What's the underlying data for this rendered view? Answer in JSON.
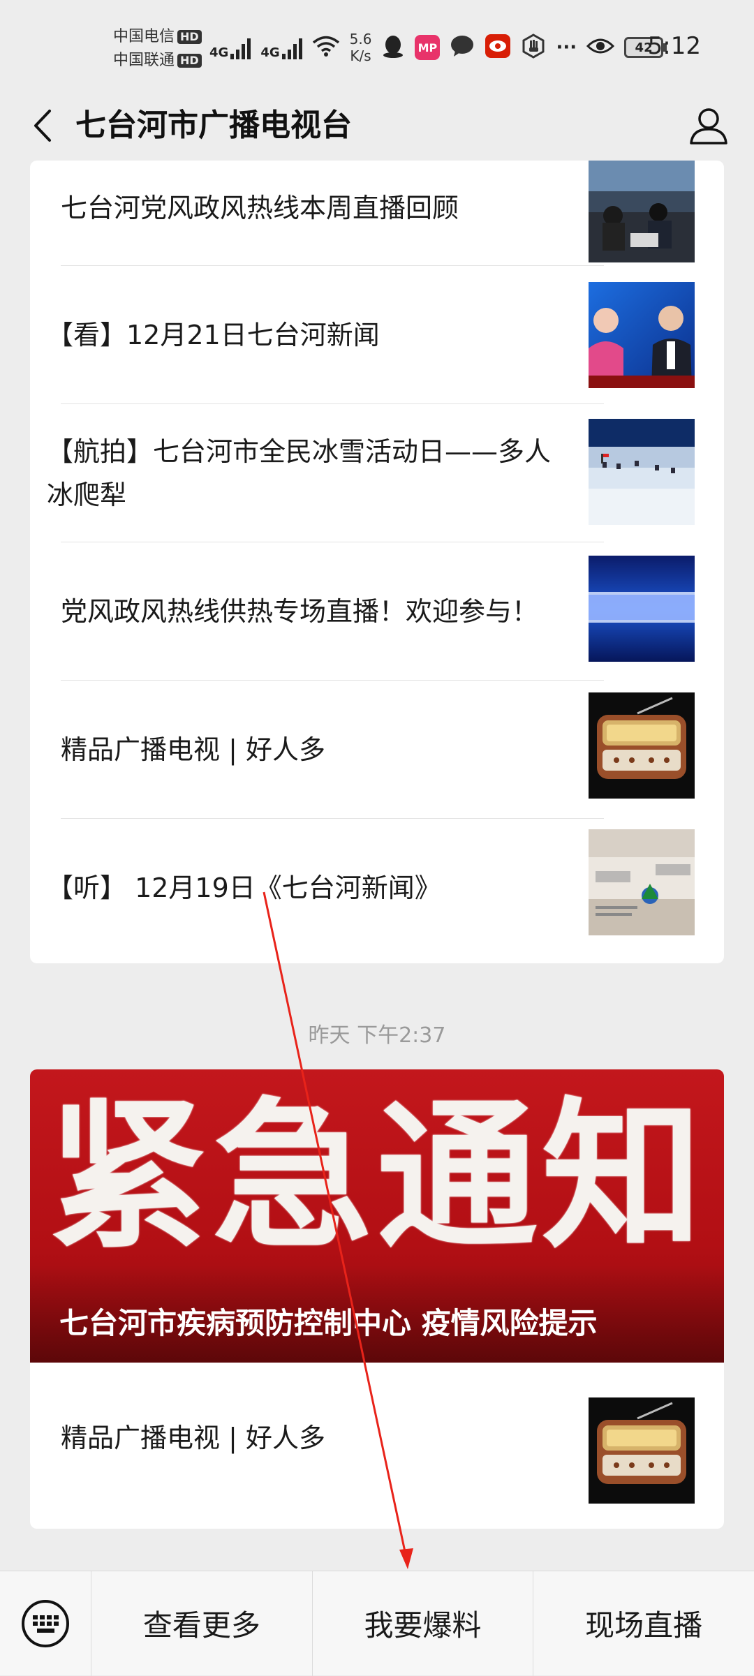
{
  "status_bar": {
    "carrier1": "中国电信",
    "carrier2": "中国联通",
    "hd_label": "HD",
    "net1": "4G",
    "net2": "4G",
    "speed_value": "5.6",
    "speed_unit": "K/s",
    "mp_label": "MP",
    "dots": "···",
    "battery": "42",
    "time": "5:12"
  },
  "header": {
    "title": "七台河市广播电视台"
  },
  "articles_card1": [
    {
      "title": "七台河党风政风热线本周直播回顾"
    },
    {
      "title": "【看】12月21日七台河新闻"
    },
    {
      "title": "【航拍】七台河市全民冰雪活动日——多人冰爬犁"
    },
    {
      "title": "党风政风热线供热专场直播！欢迎参与！"
    },
    {
      "title": "精品广播电视 | 好人多"
    },
    {
      "title": "【听】 12月19日《七台河新闻》"
    }
  ],
  "timestamp": "昨天 下午2:37",
  "banner": {
    "big_text": "紧急通知",
    "caption": "七台河市疾病预防控制中心 疫情风险提示"
  },
  "articles_card2": [
    {
      "title": "精品广播电视 | 好人多"
    }
  ],
  "bottom_menu": {
    "items": [
      "查看更多",
      "我要爆料",
      "现场直播"
    ]
  },
  "colors": {
    "background": "#ededed",
    "banner_red": "#c3171c",
    "annotation_red": "#e8231a"
  }
}
